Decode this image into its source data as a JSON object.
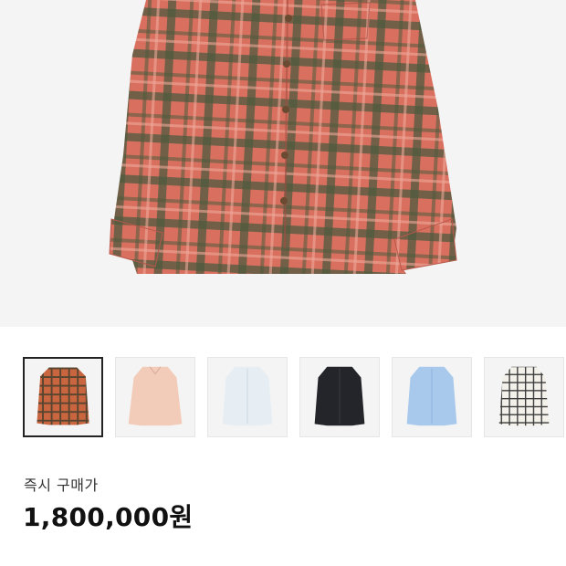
{
  "product": {
    "main_image": "red-green-plaid-shirt",
    "thumbnails": [
      {
        "name": "thumb-plaid-orange",
        "image": "orange-plaid-shirt",
        "selected": true
      },
      {
        "name": "thumb-pink-shirt",
        "image": "light-pink-shirt",
        "selected": false
      },
      {
        "name": "thumb-white-shirt",
        "image": "white-shirt",
        "selected": false
      },
      {
        "name": "thumb-black-shirt",
        "image": "black-shirt",
        "selected": false
      },
      {
        "name": "thumb-blue-shirt",
        "image": "light-blue-shirt",
        "selected": false
      },
      {
        "name": "thumb-check-shirt",
        "image": "white-check-shirt",
        "selected": false
      }
    ]
  },
  "price": {
    "label": "즉시 구매가",
    "value": "1,800,000원"
  },
  "colors": {
    "background": "#ffffff",
    "image_bg": "#f4f4f4",
    "plaid_base": "#d9705f",
    "plaid_dark": "#4f5a3e",
    "selected_border": "#222222"
  }
}
